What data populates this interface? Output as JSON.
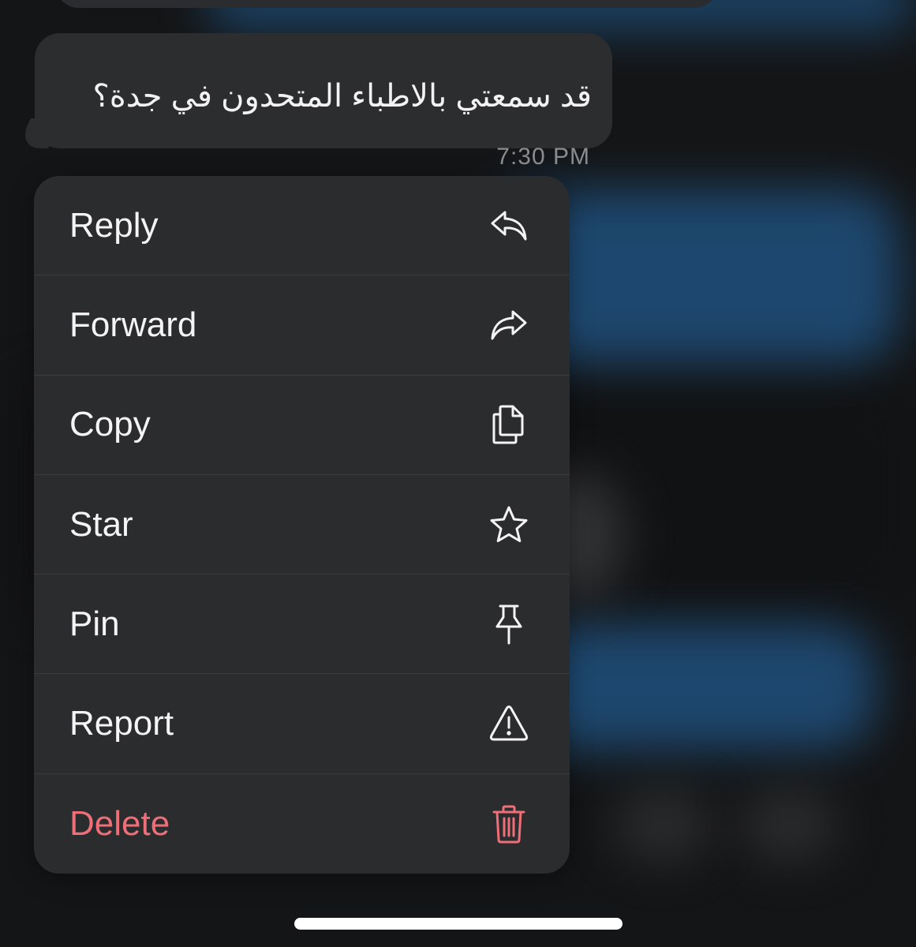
{
  "message": {
    "text": "قد سمعتي بالاطباء المتحدون في جدة؟",
    "time": "7:30 PM"
  },
  "menu": {
    "items": [
      {
        "label": "Reply",
        "icon": "reply-icon"
      },
      {
        "label": "Forward",
        "icon": "forward-icon"
      },
      {
        "label": "Copy",
        "icon": "copy-icon"
      },
      {
        "label": "Star",
        "icon": "star-icon"
      },
      {
        "label": "Pin",
        "icon": "pin-icon"
      },
      {
        "label": "Report",
        "icon": "warning-icon"
      },
      {
        "label": "Delete",
        "icon": "trash-icon"
      }
    ]
  },
  "colors": {
    "menu_background": "#2b2c2e",
    "bubble_background": "#2c2d2f",
    "text": "#f4f4f5",
    "danger": "#ee6f78",
    "timestamp": "#8b8c90"
  }
}
